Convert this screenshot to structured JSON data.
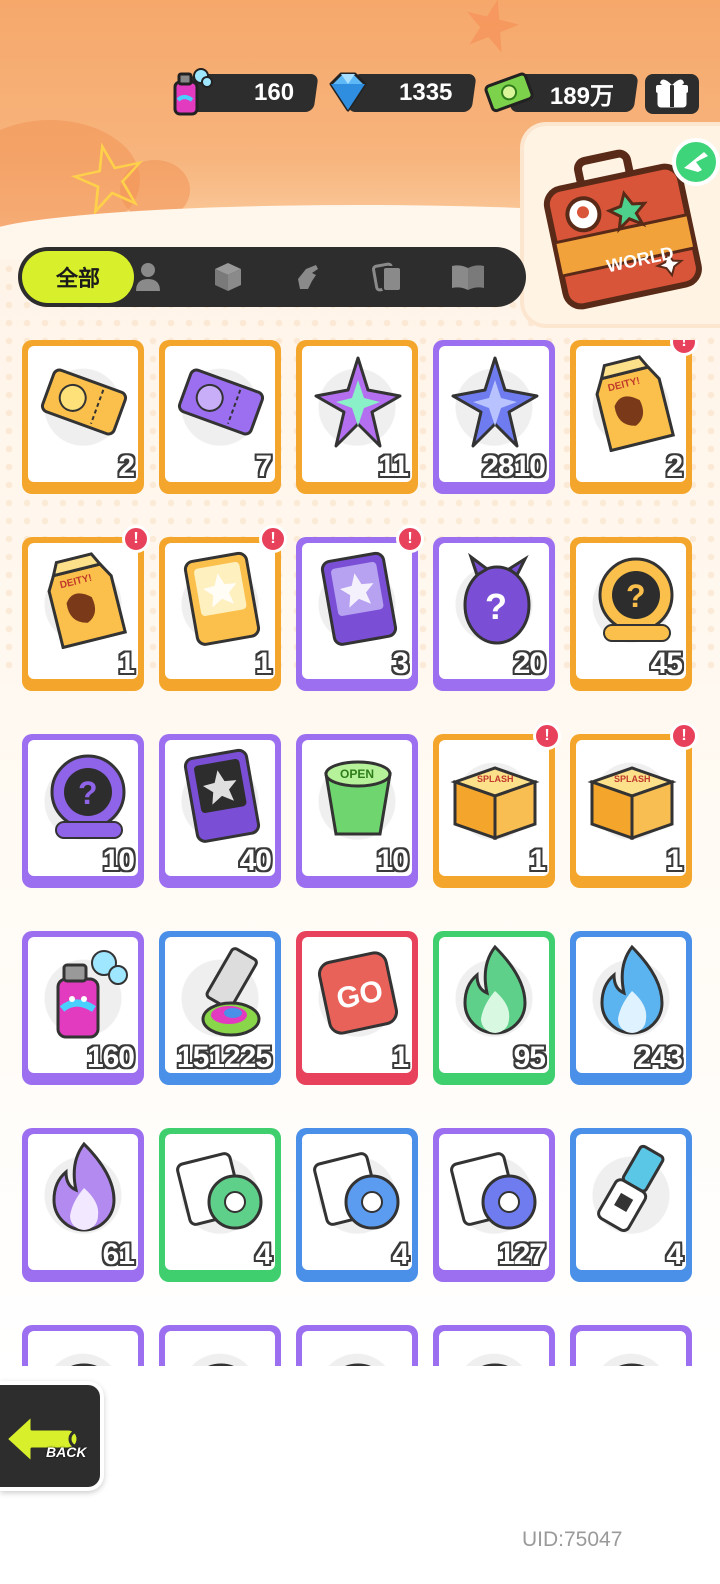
{
  "currency": [
    {
      "icon": "spray-can-icon",
      "value": "160"
    },
    {
      "icon": "diamond-icon",
      "value": "1335"
    },
    {
      "icon": "cash-icon",
      "value": "189万"
    }
  ],
  "gift_icon": "gift-box-icon",
  "world_button": {
    "label": "WORLD",
    "icon": "travel-suitcase-icon"
  },
  "tabs": {
    "all_label": "全部",
    "icons": [
      "person-icon",
      "box-icon",
      "hand-icon",
      "cards-icon",
      "book-icon"
    ]
  },
  "items": [
    {
      "name": "gold-ticket",
      "qty": "2",
      "frame": "#f4a52b",
      "badge": false
    },
    {
      "name": "purple-ticket",
      "qty": "7",
      "frame": "#f4a52b",
      "badge": false
    },
    {
      "name": "rainbow-star-shard",
      "qty": "11",
      "frame": "#f4a52b",
      "badge": false
    },
    {
      "name": "blue-star-shard",
      "qty": "2810",
      "frame": "#9b6ff0",
      "badge": false
    },
    {
      "name": "deity-milk-carton",
      "qty": "2",
      "frame": "#f4a52b",
      "badge": true
    },
    {
      "name": "deity-milk-carton",
      "qty": "1",
      "frame": "#f4a52b",
      "badge": true
    },
    {
      "name": "gold-travel-card",
      "qty": "1",
      "frame": "#f4a52b",
      "badge": true
    },
    {
      "name": "purple-travel-card",
      "qty": "3",
      "frame": "#9b6ff0",
      "badge": true
    },
    {
      "name": "purple-mystery-egg",
      "qty": "20",
      "frame": "#9b6ff0",
      "badge": false
    },
    {
      "name": "gold-deity-coin",
      "qty": "45",
      "frame": "#f4a52b",
      "badge": false
    },
    {
      "name": "purple-deity-coin",
      "qty": "10",
      "frame": "#9b6ff0",
      "badge": false
    },
    {
      "name": "purple-mystery-card",
      "qty": "40",
      "frame": "#9b6ff0",
      "badge": false
    },
    {
      "name": "green-open-cup",
      "qty": "10",
      "frame": "#9b6ff0",
      "badge": false
    },
    {
      "name": "splash-box",
      "qty": "1",
      "frame": "#f4a52b",
      "badge": true
    },
    {
      "name": "splash-box",
      "qty": "1",
      "frame": "#f4a52b",
      "badge": true
    },
    {
      "name": "spray-can",
      "qty": "160",
      "frame": "#9b6ff0",
      "badge": false
    },
    {
      "name": "paint-tube",
      "qty": "151225",
      "frame": "#4a90e8",
      "badge": false
    },
    {
      "name": "go-dice",
      "qty": "1",
      "frame": "#e8415c",
      "badge": false
    },
    {
      "name": "green-flame",
      "qty": "95",
      "frame": "#3fcf6f",
      "badge": false
    },
    {
      "name": "blue-flame",
      "qty": "243",
      "frame": "#4a90e8",
      "badge": false
    },
    {
      "name": "purple-flame",
      "qty": "61",
      "frame": "#9b6ff0",
      "badge": false
    },
    {
      "name": "green-tape-roll",
      "qty": "4",
      "frame": "#3fcf6f",
      "badge": false
    },
    {
      "name": "blue-tape-roll",
      "qty": "4",
      "frame": "#4a90e8",
      "badge": false
    },
    {
      "name": "purple-tape-roll",
      "qty": "127",
      "frame": "#9b6ff0",
      "badge": false
    },
    {
      "name": "usb-stick",
      "qty": "4",
      "frame": "#4a90e8",
      "badge": false
    },
    {
      "name": "partial-item-1",
      "qty": "",
      "frame": "#9b6ff0",
      "badge": false
    },
    {
      "name": "partial-item-2",
      "qty": "",
      "frame": "#9b6ff0",
      "badge": false
    },
    {
      "name": "partial-item-3",
      "qty": "",
      "frame": "#9b6ff0",
      "badge": false
    },
    {
      "name": "partial-item-4",
      "qty": "",
      "frame": "#9b6ff0",
      "badge": false
    },
    {
      "name": "partial-item-5",
      "qty": "",
      "frame": "#9b6ff0",
      "badge": false
    }
  ],
  "back_button": {
    "label": "BACK",
    "icon": "back-arrow-icon"
  },
  "uid": "UID:75047"
}
